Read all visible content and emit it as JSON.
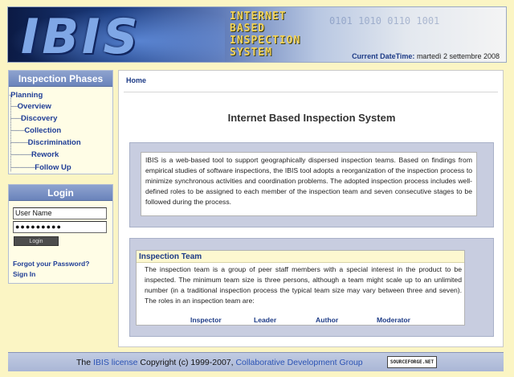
{
  "header": {
    "logo_text": "IBIS",
    "banner_lines": [
      "INTERNET",
      "BASED",
      "INSPECTION",
      "SYSTEM"
    ],
    "binary_decor": "0101 1010 0110 1001",
    "datetime_label": "Current DateTime:",
    "datetime_value": "martedì 2 settembre 2008"
  },
  "sidebar": {
    "phases_title": "Inspection Phases",
    "phases": [
      {
        "label": "Planning",
        "prefix": "-"
      },
      {
        "label": "Overview",
        "prefix": "----"
      },
      {
        "label": "Discovery",
        "prefix": "------"
      },
      {
        "label": "Collection",
        "prefix": "--------"
      },
      {
        "label": "Discrimination",
        "prefix": "----------"
      },
      {
        "label": "Rework",
        "prefix": "------------"
      },
      {
        "label": "Follow Up",
        "prefix": "--------------"
      }
    ],
    "login_title": "Login",
    "username_value": "User Name",
    "password_value": "●●●●●●●●●",
    "login_button": "Login",
    "forgot_link": "Forgot your Password?",
    "signin_link": "Sign In"
  },
  "main": {
    "breadcrumb": "Home",
    "title": "Internet Based Inspection System",
    "intro": "IBIS is a web-based tool to support geographically dispersed inspection teams. Based on findings from empirical studies of software inspections, the IBIS tool adopts a reorganization of the inspection process to minimize synchronous activities and coordination problems. The adopted inspection process includes well-defined roles to be assigned to each member of the inspection team and seven consecutive stages to be followed during the process.",
    "team_title": "Inspection Team",
    "team_text": "The inspection team is a group of peer staff members with a special interest in the product to be inspected. The minimum team size is three persons, although a team might scale up to an unlimited number (in a traditional inspection process the typical team size may vary between three and seven). The roles in an inspection team are:",
    "roles": [
      "Inspector",
      "Leader",
      "Author",
      "Moderator"
    ]
  },
  "footer": {
    "prefix": "The",
    "license_link": "IBIS license",
    "copyright": "Copyright (c) 1999-2007,",
    "group_link": "Collaborative Development Group",
    "badge": "SOURCEFORGE.NET"
  },
  "colors": {
    "page_bg": "#fbf5c4",
    "link_blue": "#1f3d96",
    "panel_head": "#7a91c5"
  }
}
